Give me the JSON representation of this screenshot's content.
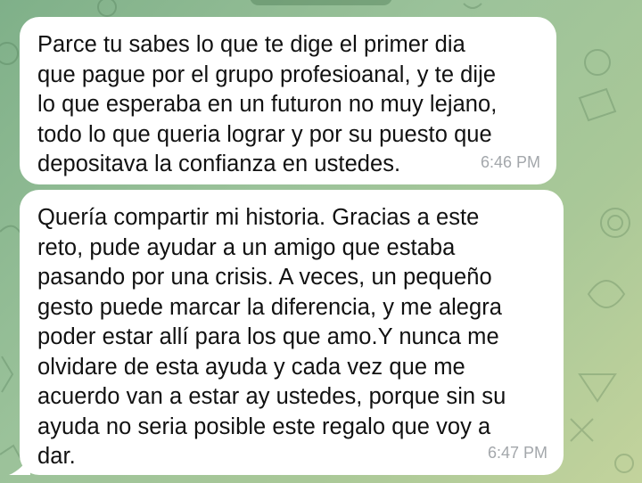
{
  "chat": {
    "messages": [
      {
        "text": "Parce tu sabes lo que te dige el primer dia\nque pague por el grupo profesioanal, y te dije\nlo que esperaba en un futuron no muy lejano,\ntodo lo que queria lograr y por su puesto que\ndepositava la confianza en ustedes.",
        "time": "6:46 PM"
      },
      {
        "text": "Quería compartir mi historia. Gracias a este\nreto, pude ayudar a un amigo que estaba\npasando por una crisis. A veces, un pequeño\ngesto puede marcar la diferencia, y me alegra\npoder estar allí para los que amo.Y nunca me\nolvidare de esta ayuda y cada vez que me\nacuerdo van a estar ay ustedes, porque sin su\nayuda no seria posible este regalo que voy a\ndar.",
        "time": "6:47 PM"
      }
    ]
  },
  "colors": {
    "bubble": "#ffffff",
    "timestamp": "#a3a7ab",
    "background": "#9bc29a"
  }
}
